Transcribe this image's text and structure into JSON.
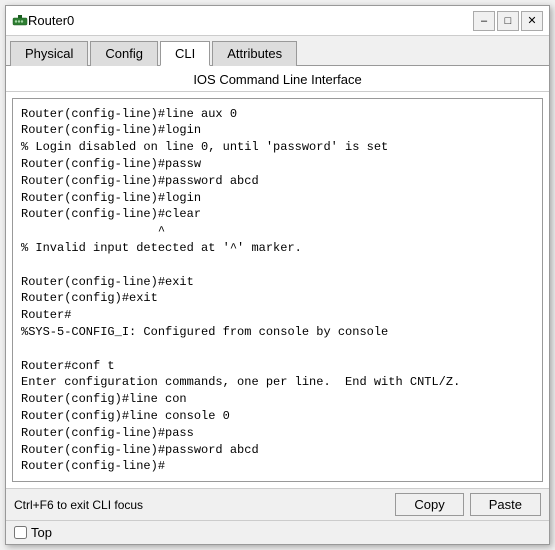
{
  "window": {
    "title": "Router0",
    "controls": {
      "minimize": "–",
      "maximize": "□",
      "close": "✕"
    }
  },
  "tabs": [
    {
      "id": "physical",
      "label": "Physical"
    },
    {
      "id": "config",
      "label": "Config"
    },
    {
      "id": "cli",
      "label": "CLI"
    },
    {
      "id": "attributes",
      "label": "Attributes"
    }
  ],
  "active_tab": "CLI",
  "cli": {
    "section_title": "IOS Command Line Interface",
    "terminal_content": "% Invalid input detected at '^' marker.\n\nRouter(config-line)#line aux 0\nRouter(config-line)#login\n% Login disabled on line 0, until 'password' is set\nRouter(config-line)#passw\nRouter(config-line)#password abcd\nRouter(config-line)#login\nRouter(config-line)#clear\n                   ^\n% Invalid input detected at '^' marker.\n\nRouter(config-line)#exit\nRouter(config)#exit\nRouter#\n%SYS-5-CONFIG_I: Configured from console by console\n\nRouter#conf t\nEnter configuration commands, one per line.  End with CNTL/Z.\nRouter(config)#line con\nRouter(config)#line console 0\nRouter(config-line)#pass\nRouter(config-line)#password abcd\nRouter(config-line)#",
    "status_text": "Ctrl+F6 to exit CLI focus",
    "copy_button": "Copy",
    "paste_button": "Paste"
  },
  "footer": {
    "top_checkbox_label": "Top",
    "top_checked": false
  }
}
